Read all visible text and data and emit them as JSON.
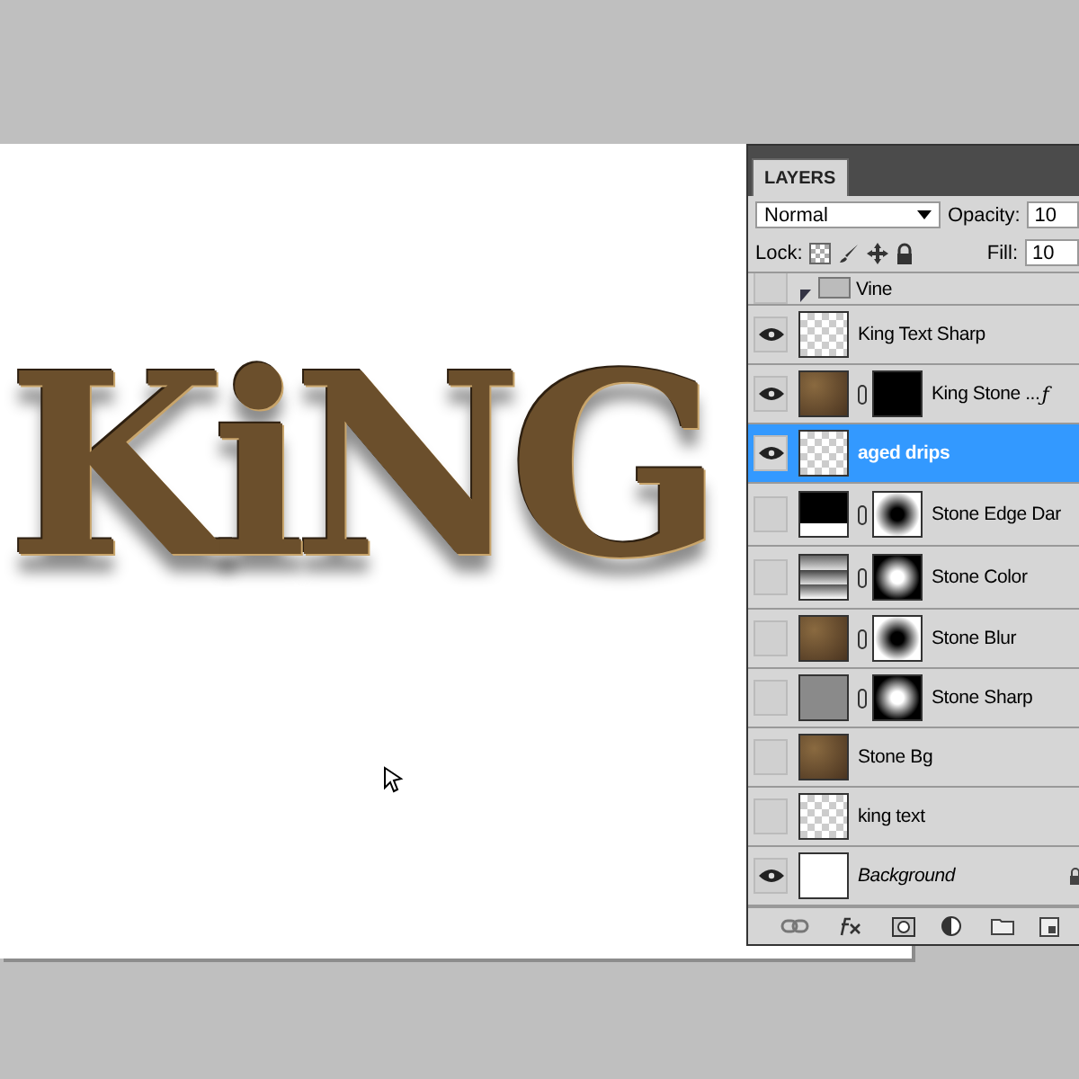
{
  "canvas": {
    "art_text": "KiNG"
  },
  "layers_panel": {
    "tab": {
      "label": "LAYERS",
      "selected": true
    },
    "blend_mode": "Normal",
    "opacity_label": "Opacity:",
    "opacity": "10",
    "lock_label": "Lock:",
    "fill_label": "Fill:",
    "fill": "10",
    "layers": [
      {
        "name": "Vine",
        "kind": "group",
        "visible": false,
        "selected": false,
        "thumbnail": {
          "kind": "folder"
        },
        "italic": false,
        "locked": false
      },
      {
        "name": "King Text Sharp",
        "kind": "layer",
        "visible": true,
        "selected": false,
        "thumbnail": {
          "kind": "checker"
        },
        "italic": false,
        "locked": false
      },
      {
        "name": "King Stone ...",
        "kind": "layer",
        "visible": true,
        "selected": false,
        "thumbnail": {
          "kind": "texture"
        },
        "mask": {
          "kind": "text"
        },
        "fx": "ƒ",
        "italic": false,
        "locked": false
      },
      {
        "name": "aged drips",
        "kind": "layer",
        "visible": true,
        "selected": true,
        "thumbnail": {
          "kind": "checker"
        },
        "italic": false,
        "locked": false
      },
      {
        "name": "Stone Edge Dar",
        "kind": "adjustment",
        "visible": false,
        "selected": false,
        "thumbnail": {
          "kind": "levels"
        },
        "mask": {
          "kind": "dark"
        },
        "italic": false,
        "locked": false
      },
      {
        "name": "Stone Color",
        "kind": "adjustment",
        "visible": false,
        "selected": false,
        "thumbnail": {
          "kind": "gradient"
        },
        "mask": {
          "kind": "light"
        },
        "italic": false,
        "locked": false
      },
      {
        "name": "Stone Blur",
        "kind": "layer",
        "visible": false,
        "selected": false,
        "thumbnail": {
          "kind": "texture"
        },
        "mask": {
          "kind": "dark"
        },
        "italic": false,
        "locked": false
      },
      {
        "name": "Stone Sharp",
        "kind": "layer",
        "visible": false,
        "selected": false,
        "thumbnail": {
          "kind": "gray"
        },
        "mask": {
          "kind": "light"
        },
        "italic": false,
        "locked": false
      },
      {
        "name": "Stone Bg",
        "kind": "layer",
        "visible": false,
        "selected": false,
        "thumbnail": {
          "kind": "texture"
        },
        "italic": false,
        "locked": false
      },
      {
        "name": "king text",
        "kind": "layer",
        "visible": false,
        "selected": false,
        "thumbnail": {
          "kind": "checker"
        },
        "italic": false,
        "locked": false
      },
      {
        "name": "Background",
        "kind": "layer",
        "visible": true,
        "selected": false,
        "thumbnail": {
          "kind": "white"
        },
        "italic": true,
        "locked": true
      }
    ]
  }
}
